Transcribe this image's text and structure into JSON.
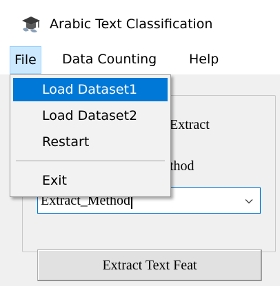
{
  "window": {
    "title": "Arabic Text Classification",
    "icon": "graduation-cap-icon"
  },
  "menubar": {
    "file": "File",
    "data_counting": "Data Counting",
    "help": "Help"
  },
  "file_menu": {
    "items": [
      "Load Dataset1",
      "Load Dataset2",
      "Restart"
    ],
    "exit": "Exit",
    "highlighted": "Load Dataset1"
  },
  "form": {
    "extract_label": "Extract",
    "method_label": "thod",
    "extract_method_value": "Extract_Method",
    "extract_button": "Extract Text Feat"
  },
  "colors": {
    "highlight": "#0078d7",
    "menu_hover": "#cce8ff",
    "focus_border": "#0078d7"
  }
}
